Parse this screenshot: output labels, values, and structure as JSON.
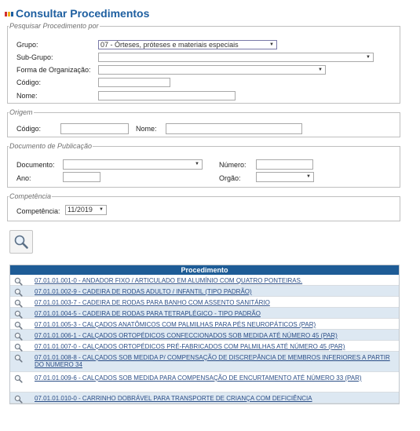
{
  "page": {
    "title": "Consultar Procedimentos"
  },
  "colors": {
    "accent_blue": "#1e5fa0",
    "header_blue": "#1e5c96",
    "mark_red": "#d12f2f",
    "mark_yellow": "#f2b21b"
  },
  "filters": {
    "legend": "Pesquisar Procedimento por",
    "grupo": {
      "label": "Grupo:",
      "value": "07 - Órteses, próteses e materiais especiais"
    },
    "subgrupo": {
      "label": "Sub-Grupo:",
      "value": ""
    },
    "forma": {
      "label": "Forma de Organização:",
      "value": ""
    },
    "codigo": {
      "label": "Código:",
      "value": ""
    },
    "nome": {
      "label": "Nome:",
      "value": ""
    }
  },
  "origem": {
    "legend": "Origem",
    "codigo_label": "Código:",
    "nome_label": "Nome:"
  },
  "documento": {
    "legend": "Documento de Publicação",
    "documento_label": "Documento:",
    "numero_label": "Número:",
    "ano_label": "Ano:",
    "orgao_label": "Orgão:"
  },
  "competencia": {
    "legend": "Competência",
    "label": "Competência:",
    "value": "11/2019"
  },
  "results": {
    "header": "Procedimento",
    "rows": [
      "07.01.01.001-0 - ANDADOR FIXO / ARTICULADO EM ALUMÍNIO COM QUATRO PONTEIRAS.",
      "07.01.01.002-9 - CADEIRA DE RODAS ADULTO / INFANTIL (TIPO PADRÃO)",
      "07.01.01.003-7 - CADEIRA DE RODAS PARA BANHO COM ASSENTO SANITÁRIO",
      "07.01.01.004-5 - CADEIRA DE RODAS PARA TETRAPLÉGICO - TIPO PADRÃO",
      "07.01.01.005-3 - CALÇADOS ANATÔMICOS COM PALMILHAS PARA PÉS NEUROPÁTICOS (PAR)",
      "07.01.01.006-1 - CALÇADOS ORTOPÉDICOS CONFECCIONADOS SOB MEDIDA ATÉ NÚMERO 45 (PAR)",
      "07.01.01.007-0 - CALÇADOS ORTOPÉDICOS PRÉ-FABRICADOS COM PALMILHAS ATÉ NÚMERO 45 (PAR)",
      "07.01.01.008-8 - CALÇADOS SOB MEDIDA P/ COMPENSAÇÃO DE DISCREPÂNCIA DE MEMBROS INFERIORES A PARTIR DO NUMERO 34",
      "07.01.01.009-6 - CALÇADOS SOB MEDIDA PARA COMPENSAÇÃO DE ENCURTAMENTO ATÉ NÚMERO 33 (PAR)",
      "07.01.01.010-0 - CARRINHO DOBRÁVEL PARA TRANSPORTE DE CRIANÇA COM DEFICIÊNCIA"
    ]
  }
}
